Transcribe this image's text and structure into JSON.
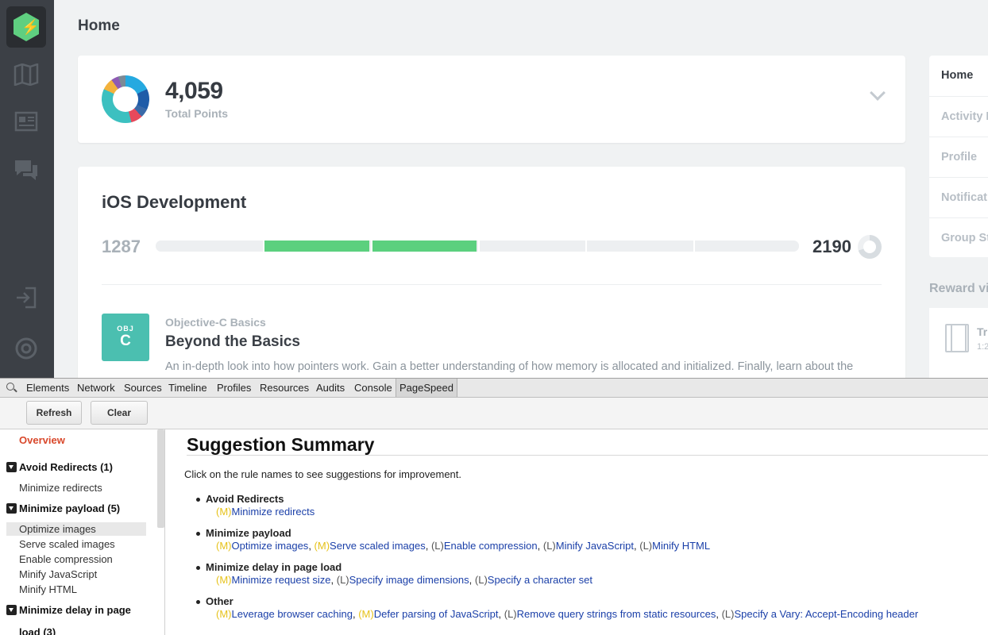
{
  "app": {
    "page_title": "Home"
  },
  "sidebar": {
    "logo_letter": "⚡",
    "icons": [
      "map-icon",
      "library-icon",
      "chat-icon",
      "sign-in-icon",
      "help-icon"
    ]
  },
  "points": {
    "value": "4,059",
    "label": "Total Points",
    "breakdown_colors": [
      "#25a9e0",
      "#1f5ca8",
      "#3a6aa8",
      "#e8495b",
      "#3cc0c0",
      "#f3b23c",
      "#8e5bb4",
      "#7b8a96"
    ]
  },
  "track": {
    "title": "iOS Development",
    "min": "1287",
    "max": "2190",
    "progress_fraction": 0.5,
    "segments_total": 6,
    "segments_complete": 2,
    "segments_complete_start": 1,
    "accent_color": "#5bd07e"
  },
  "course": {
    "badge_top": "OBJ",
    "badge_letter": "C",
    "category": "Objective-C Basics",
    "title": "Beyond the Basics",
    "description": "An in-depth look into how pointers work. Gain a better understanding of how memory is allocated and initialized. Finally, learn about the"
  },
  "right_nav": {
    "items": [
      "Home",
      "Activity F",
      "Profile",
      "Notificat",
      "Group St"
    ],
    "active": "Home",
    "reward_heading": "Reward vi",
    "reward_title": "Tr",
    "reward_sub": "1:2"
  },
  "devtools": {
    "tabs": [
      "Elements",
      "Network",
      "Sources",
      "Timeline",
      "Profiles",
      "Resources",
      "Audits",
      "Console",
      "PageSpeed"
    ],
    "active_tab": "PageSpeed",
    "buttons": {
      "refresh": "Refresh",
      "clear": "Clear"
    },
    "tree": {
      "overview": "Overview",
      "groups": [
        {
          "label": "Avoid Redirects (1)",
          "items": [
            "Minimize redirects"
          ]
        },
        {
          "label": "Minimize payload (5)",
          "items": [
            "Optimize images",
            "Serve scaled images",
            "Enable compression",
            "Minify JavaScript",
            "Minify HTML"
          ]
        },
        {
          "label": "Minimize delay in page",
          "label2": "load (3)",
          "items": []
        }
      ],
      "selected": "Optimize images"
    },
    "summary": {
      "title": "Suggestion Summary",
      "intro": "Click on the rule names to see suggestions for improvement.",
      "rules": [
        {
          "name": "Avoid Redirects",
          "suggestions": [
            {
              "p": "(M)",
              "t": "Minimize redirects"
            }
          ]
        },
        {
          "name": "Minimize payload",
          "suggestions": [
            {
              "p": "(M)",
              "t": "Optimize images"
            },
            {
              "p": "(M)",
              "t": "Serve scaled images"
            },
            {
              "p": "(L)",
              "t": "Enable compression"
            },
            {
              "p": "(L)",
              "t": "Minify JavaScript"
            },
            {
              "p": "(L)",
              "t": "Minify HTML"
            }
          ]
        },
        {
          "name": "Minimize delay in page load",
          "suggestions": [
            {
              "p": "(M)",
              "t": "Minimize request size"
            },
            {
              "p": "(L)",
              "t": "Specify image dimensions"
            },
            {
              "p": "(L)",
              "t": "Specify a character set"
            }
          ]
        },
        {
          "name": "Other",
          "suggestions": [
            {
              "p": "(M)",
              "t": "Leverage browser caching"
            },
            {
              "p": "(M)",
              "t": "Defer parsing of JavaScript"
            },
            {
              "p": "(L)",
              "t": "Remove query strings from static resources"
            },
            {
              "p": "(L)",
              "t": "Specify a Vary: Accept-Encoding header"
            }
          ]
        }
      ]
    }
  }
}
